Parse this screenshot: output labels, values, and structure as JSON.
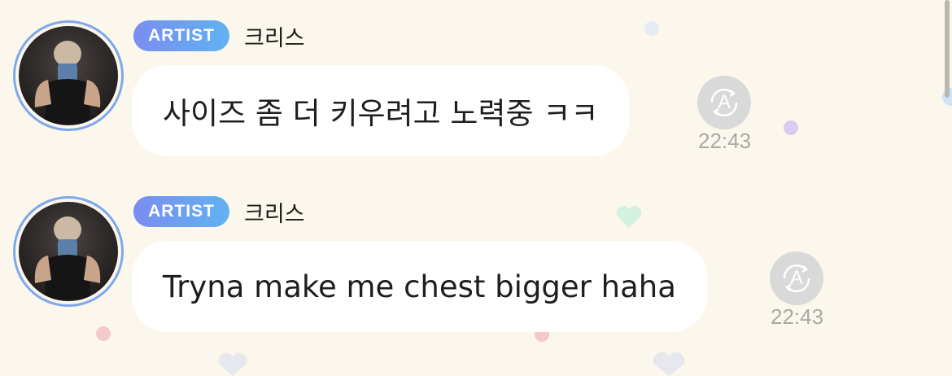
{
  "messages": [
    {
      "badge": "ARTIST",
      "sender": "크리스",
      "text": "사이즈 좀 더 키우려고 노력중 ㅋㅋ",
      "time": "22:43",
      "translate_icon_label": "A"
    },
    {
      "badge": "ARTIST",
      "sender": "크리스",
      "text": "Tryna make me chest bigger haha",
      "time": "22:43",
      "translate_icon_label": "A"
    }
  ],
  "colors": {
    "background": "#fcf7ec",
    "badge_gradient_start": "#7b8df0",
    "badge_gradient_end": "#60b2f2",
    "avatar_ring": "#7fa8ec",
    "bubble": "#ffffff",
    "timestamp": "#a9a9a9"
  }
}
